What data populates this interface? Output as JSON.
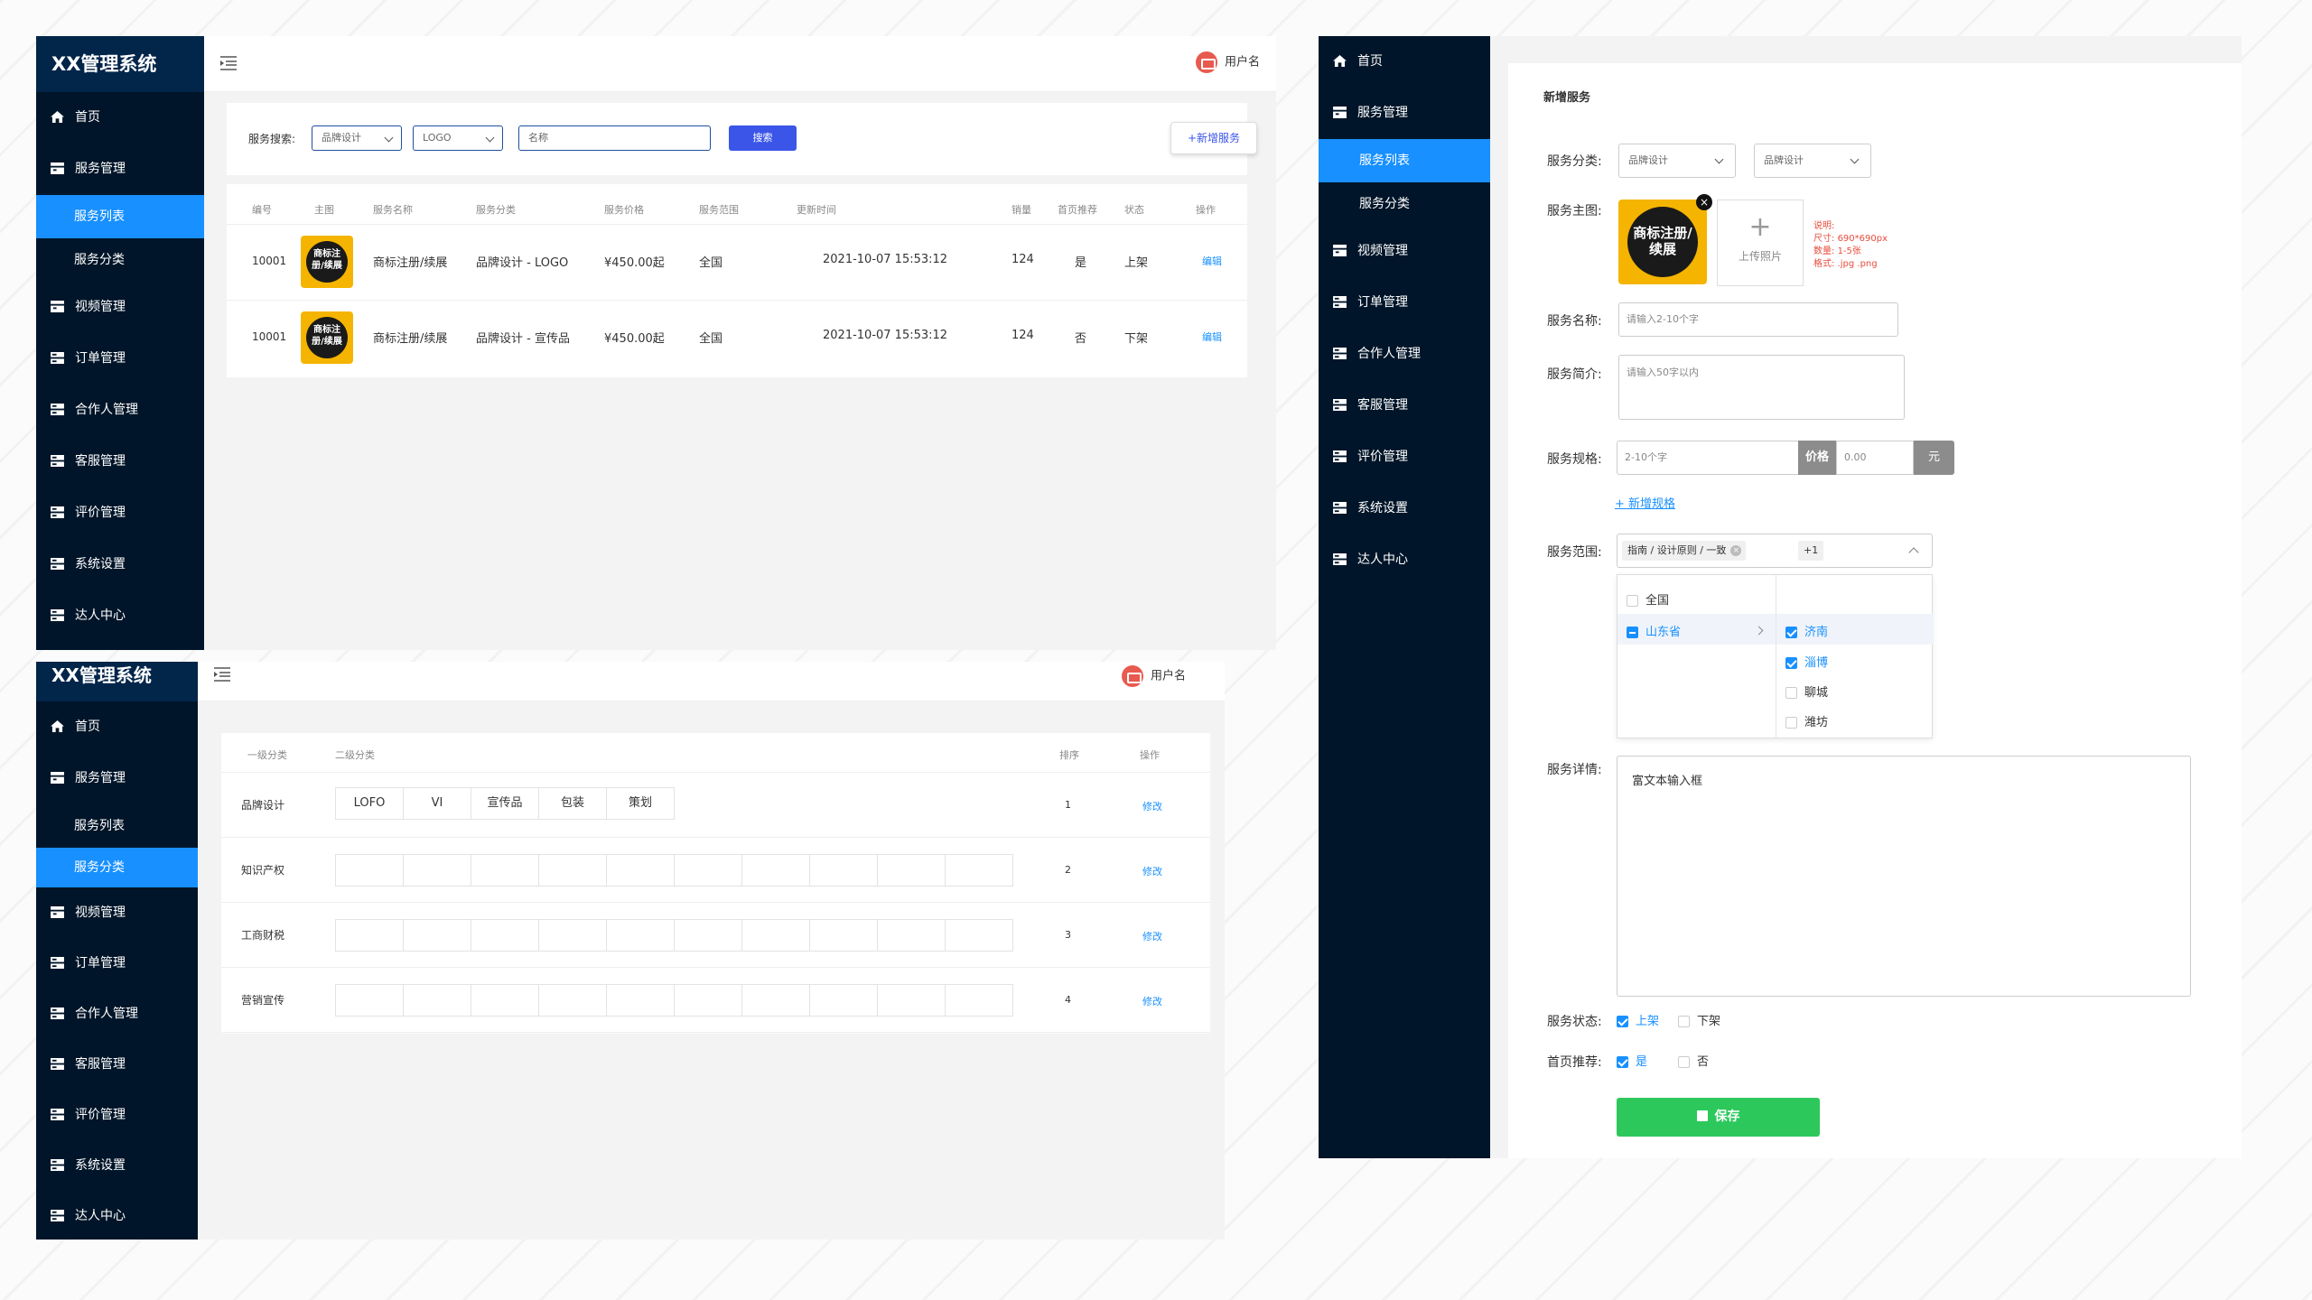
{
  "common": {
    "brand": "XX管理系统",
    "username": "用户名"
  },
  "menu": {
    "home": "首页",
    "service": "服务管理",
    "service_list": "服务列表",
    "service_category": "服务分类",
    "video": "视频管理",
    "order": "订单管理",
    "partner": "合作人管理",
    "cs": "客服管理",
    "review": "评价管理",
    "settings": "系统设置",
    "expert": "达人中心"
  },
  "list_panel": {
    "search_label": "服务搜索:",
    "filter1": "品牌设计",
    "filter2": "LOGO",
    "name_placeholder": "名称",
    "search_button": "搜索",
    "add_button": "+新增服务",
    "columns": [
      "编号",
      "主图",
      "服务名称",
      "服务分类",
      "服务价格",
      "服务范围",
      "更新时间",
      "销量",
      "首页推荐",
      "状态",
      "操作"
    ],
    "rows": [
      {
        "id": "10001",
        "thumb_text": "商标注册/续展",
        "name": "商标注册/续展",
        "category": "品牌设计 - LOGO",
        "price": "¥450.00起",
        "scope": "全国",
        "updated": "2021-10-07 15:53:12",
        "sales": "124",
        "recommend": "是",
        "status": "上架",
        "action": "编辑"
      },
      {
        "id": "10001",
        "thumb_text": "商标注册/续展",
        "name": "商标注册/续展",
        "category": "品牌设计 - 宣传品",
        "price": "¥450.00起",
        "scope": "全国",
        "updated": "2021-10-07 15:53:12",
        "sales": "124",
        "recommend": "否",
        "status": "下架",
        "action": "编辑"
      }
    ]
  },
  "category_panel": {
    "columns": [
      "一级分类",
      "二级分类",
      "排序",
      "操作"
    ],
    "rows": [
      {
        "name": "品牌设计",
        "tags": [
          "LOFO",
          "VI",
          "宣传品",
          "包装",
          "策划"
        ],
        "order": "1",
        "action": "修改"
      },
      {
        "name": "知识产权",
        "tags": [],
        "order": "2",
        "action": "修改"
      },
      {
        "name": "工商财税",
        "tags": [],
        "order": "3",
        "action": "修改"
      },
      {
        "name": "营销宣传",
        "tags": [],
        "order": "4",
        "action": "修改"
      }
    ]
  },
  "form_panel": {
    "title": "新增服务",
    "labels": {
      "category": "服务分类:",
      "image": "服务主图:",
      "name": "服务名称:",
      "intro": "服务简介:",
      "spec": "服务规格:",
      "scope": "服务范围:",
      "detail": "服务详情:",
      "status": "服务状态:",
      "recommend": "首页推荐:"
    },
    "category1": "品牌设计",
    "category2": "品牌设计",
    "upload_label": "上传照片",
    "thumb_text": "商标注册/续展",
    "image_hint": {
      "title": "说明:",
      "size_label": "尺寸:",
      "size": "690*690px",
      "count_label": "数量:",
      "count": "1-5张",
      "format_label": "格式:",
      "format": ".jpg .png"
    },
    "name_placeholder": "请输入2-10个字",
    "intro_placeholder": "请输入50字以内",
    "spec_placeholder": "2-10个字",
    "price_label": "价格",
    "price_placeholder": "0.00",
    "unit": "元",
    "add_spec": "+ 新增规格",
    "scope_tag": "指南 / 设计原则 / 一致",
    "scope_more": "+1",
    "cascader": {
      "left": [
        "全国",
        "山东省"
      ],
      "right": [
        "济南",
        "淄博",
        "聊城",
        "潍坊"
      ]
    },
    "detail_placeholder": "富文本输入框",
    "status_on": "上架",
    "status_off": "下架",
    "rec_yes": "是",
    "rec_no": "否",
    "save": "保存"
  }
}
